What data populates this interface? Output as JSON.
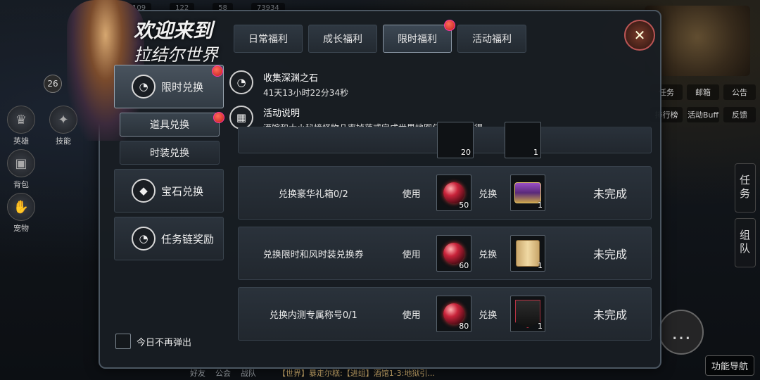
{
  "hud": {
    "top_values": [
      "109",
      "122",
      "58",
      "73934"
    ],
    "level": "26",
    "left_buttons": [
      {
        "label": "英雄",
        "icon": "hero-icon"
      },
      {
        "label": "技能",
        "icon": "skill-icon"
      },
      {
        "label": "背包",
        "icon": "bag-icon"
      },
      {
        "label": "宠物",
        "icon": "pet-icon"
      }
    ],
    "right_row1": [
      "任务",
      "邮箱",
      "公告"
    ],
    "right_row2": [
      "排行榜",
      "活动Buff",
      "反馈"
    ],
    "right_tabs": [
      "任务",
      "组队"
    ],
    "func_nav": "功能导航",
    "bottom_links": [
      "好友",
      "公会",
      "战队"
    ],
    "chat_line": "【世界】暴走尔糕:【进组】酒馆1-3:地狱引..."
  },
  "welcome": {
    "line1": "欢迎来到",
    "line2": "拉结尔世界"
  },
  "tabs": [
    {
      "label": "日常福利",
      "active": false,
      "dot": false
    },
    {
      "label": "成长福利",
      "active": false,
      "dot": false
    },
    {
      "label": "限时福利",
      "active": true,
      "dot": true
    },
    {
      "label": "活动福利",
      "active": false,
      "dot": false
    }
  ],
  "menu": {
    "main1": {
      "label": "限时兑换",
      "icon": "gauge-icon"
    },
    "sub1": "道具兑换",
    "sub2": "时装兑换",
    "main2": {
      "label": "宝石兑换",
      "icon": "gem-icon"
    },
    "main3": {
      "label": "任务链奖励",
      "icon": "gauge-icon"
    }
  },
  "info": {
    "title": "收集深渊之石",
    "timer": "41天13小时22分34秒",
    "desc_title": "活动说明",
    "desc": "酒馆和大小秘境怪物几率掉落或完成世界地图任务链可获得"
  },
  "partial_row": {
    "cost": "20",
    "reward": "1"
  },
  "rows": [
    {
      "name": "兑换豪华礼箱0/2",
      "use": "使用",
      "cost": "50",
      "trade": "兑换",
      "reward": "1",
      "reward_icon": "chest-icon",
      "status": "未完成"
    },
    {
      "name": "兑换限时和风时装兑换券",
      "use": "使用",
      "cost": "60",
      "trade": "兑换",
      "reward": "1",
      "reward_icon": "scroll-icon",
      "status": "未完成"
    },
    {
      "name": "兑换内测专属称号0/1",
      "use": "使用",
      "cost": "80",
      "trade": "兑换",
      "reward": "1",
      "reward_icon": "banner-icon",
      "status": "未完成"
    }
  ],
  "checkbox_label": "今日不再弹出"
}
